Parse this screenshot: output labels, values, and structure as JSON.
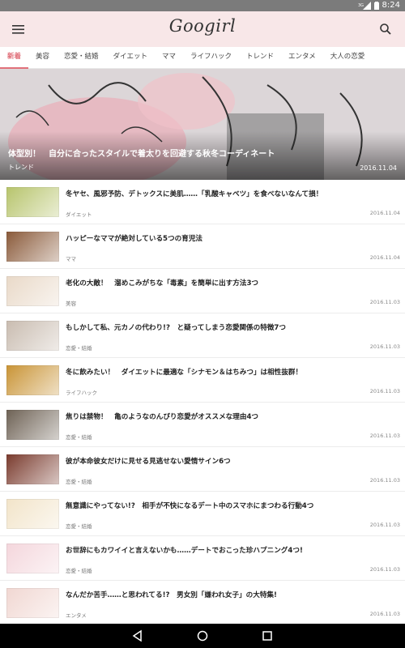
{
  "status_bar": {
    "time": "8:24",
    "network": "3G"
  },
  "app": {
    "logo": "Googirl"
  },
  "tabs": [
    "新着",
    "美容",
    "恋愛・結婚",
    "ダイエット",
    "ママ",
    "ライフハック",
    "トレンド",
    "エンタメ",
    "大人の恋愛"
  ],
  "active_tab": "新着",
  "hero": {
    "title": "体型別！　自分に合ったスタイルで着太りを回避する秋冬コーディネート",
    "category": "トレンド",
    "date": "2016.11.04"
  },
  "articles": [
    {
      "title": "冬ヤセ、風邪予防、デトックスに美肌……「乳酸キャベツ」を食べないなんて損！",
      "category": "ダイエット",
      "date": "2016.11.04",
      "thumb_color": "#b7c46c"
    },
    {
      "title": "ハッピーなママが絶対している5つの育児法",
      "category": "ママ",
      "date": "2016.11.04",
      "thumb_color": "#8a5a3a"
    },
    {
      "title": "老化の大敵！　溜めこみがちな「毒素」を簡単に出す方法3つ",
      "category": "美容",
      "date": "2016.11.03",
      "thumb_color": "#e9d9c8"
    },
    {
      "title": "もしかして私、元カノの代わり!?　と疑ってしまう恋愛関係の特徴7つ",
      "category": "恋愛・結婚",
      "date": "2016.11.03",
      "thumb_color": "#c9bcb0"
    },
    {
      "title": "冬に飲みたい！　ダイエットに最適な「シナモン＆はちみつ」は相性抜群！",
      "category": "ライフハック",
      "date": "2016.11.03",
      "thumb_color": "#c99436"
    },
    {
      "title": "焦りは禁物！　亀のようなのんびり恋愛がオススメな理由4つ",
      "category": "恋愛・結婚",
      "date": "2016.11.03",
      "thumb_color": "#6e6255"
    },
    {
      "title": "彼が本命彼女だけに見せる見逃せない愛情サイン6つ",
      "category": "恋愛・結婚",
      "date": "2016.11.03",
      "thumb_color": "#7a3b2e"
    },
    {
      "title": "無意識にやってない!?　相手が不快になるデート中のスマホにまつわる行動4つ",
      "category": "恋愛・結婚",
      "date": "2016.11.03",
      "thumb_color": "#f2e4c9"
    },
    {
      "title": "お世辞にもカワイイと言えないかも……デートでおこった珍ハプニング4つ!",
      "category": "恋愛・結婚",
      "date": "2016.11.03",
      "thumb_color": "#f4d6dc"
    },
    {
      "title": "なんだか苦手……と思われてる!?　男女別「嫌われ女子」の大特集!",
      "category": "エンタメ",
      "date": "2016.11.03",
      "thumb_color": "#f1d7d2"
    }
  ]
}
